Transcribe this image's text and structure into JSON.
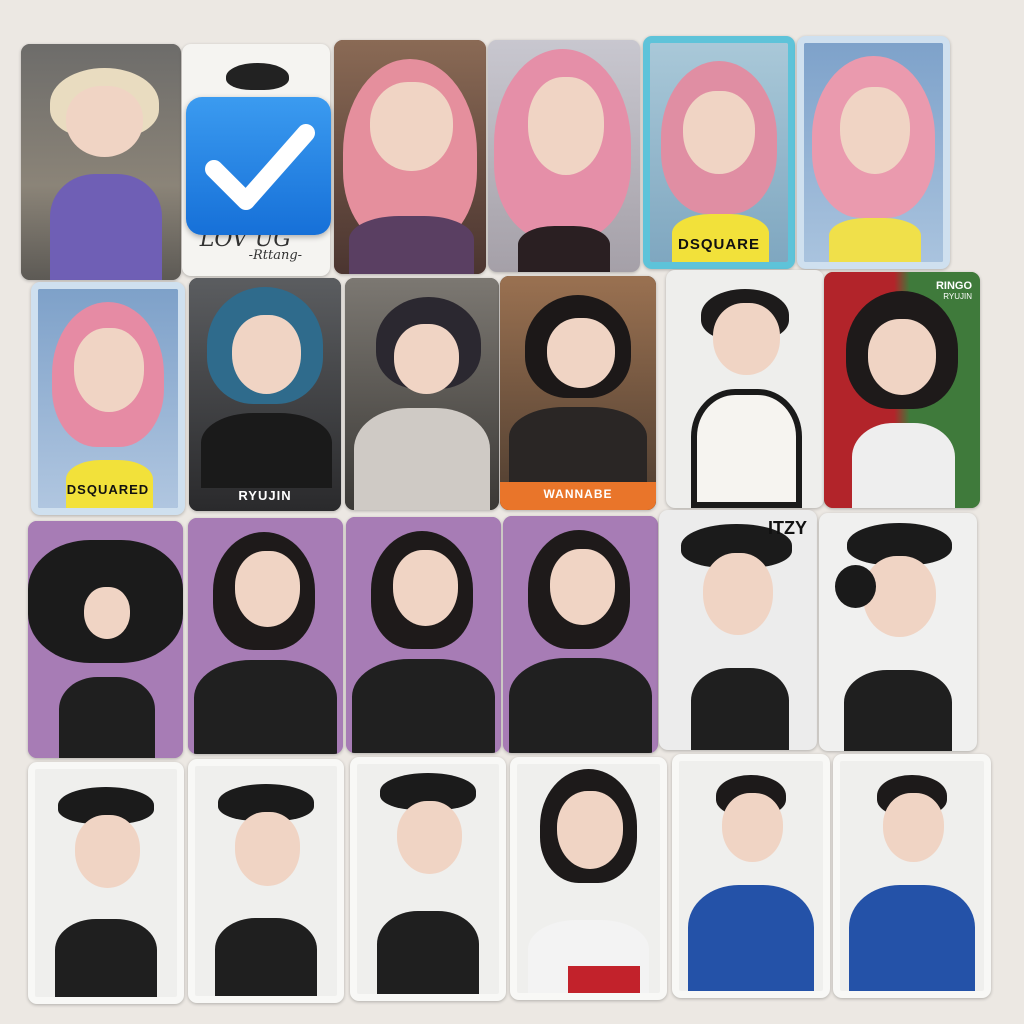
{
  "cards": [
    {
      "id": "r1c1",
      "caption": ""
    },
    {
      "id": "r1c2",
      "caption": ""
    },
    {
      "id": "r1c3",
      "caption": ""
    },
    {
      "id": "r1c4",
      "caption": ""
    },
    {
      "id": "r1c5",
      "caption": ""
    },
    {
      "id": "r1c6",
      "caption": ""
    },
    {
      "id": "r2c1",
      "caption": ""
    },
    {
      "id": "r2c2",
      "caption": "RYUJIN"
    },
    {
      "id": "r2c3",
      "caption": ""
    },
    {
      "id": "r2c4",
      "caption": "WANNABE"
    },
    {
      "id": "r2c5",
      "caption": ""
    },
    {
      "id": "r2c6",
      "caption": "RINGO"
    },
    {
      "id": "r3c5",
      "caption": "ITZY"
    }
  ],
  "texts": {
    "card_r1c2_handwriting": "LOV UG",
    "card_r1c2_signature": "-Rttang-",
    "card_r1c5_shirt": "DSQUARE",
    "card_r2c1_shirt": "DSQUARED",
    "card_r2c6_sub": "RYUJIN"
  },
  "overlay": {
    "icon": "checkmark-icon",
    "color": "#1f7fe6"
  }
}
